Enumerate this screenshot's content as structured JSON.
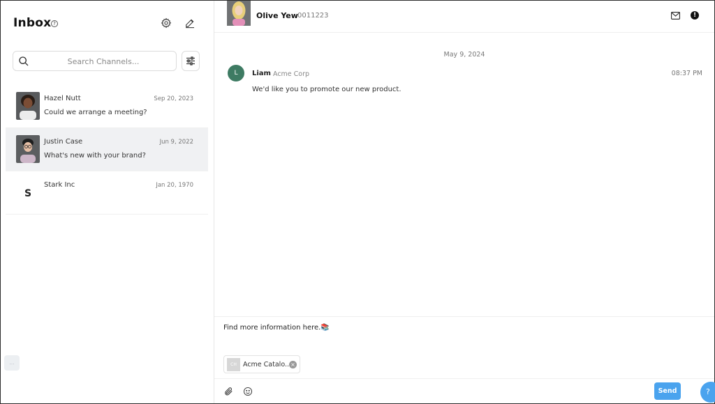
{
  "sidebar": {
    "title": "Inbox",
    "help_glyph": "?",
    "icons": {
      "settings": "gear-icon",
      "compose": "pencil-icon",
      "search": "search-icon",
      "filter": "sliders-icon"
    },
    "search": {
      "placeholder": "Search Channels...",
      "value": ""
    },
    "conversations": [
      {
        "name": "Hazel Nutt",
        "date": "Sep 20, 2023",
        "preview": "Could we arrange a meeting?",
        "active": false
      },
      {
        "name": "Justin Case",
        "date": "Jun 9, 2022",
        "preview": "What's new with your brand?",
        "active": true
      },
      {
        "name": "Stark Inc",
        "date": "Jan 20, 1970",
        "preview": "",
        "avatar_letter": "S",
        "active": false
      }
    ]
  },
  "chat": {
    "header": {
      "name": "Olive Yew",
      "id": "0011223",
      "icons": [
        "mail-icon",
        "alert-icon"
      ]
    },
    "date_separator": "May 9, 2024",
    "messages": [
      {
        "avatar_letter": "L",
        "sender": "Liam",
        "company": "Acme Corp",
        "time": "08:37 PM",
        "text": "We'd like you to promote our new product."
      }
    ],
    "composer": {
      "text": "Find more information here.",
      "attachment": {
        "thumb": "CH",
        "name": "Acme Catalo..."
      },
      "send_label": "Send",
      "help_glyph": "?"
    }
  },
  "colors": {
    "accent": "#4aa3ee",
    "message_avatar": "#3e7b63",
    "active_row": "#f0f1f3"
  }
}
